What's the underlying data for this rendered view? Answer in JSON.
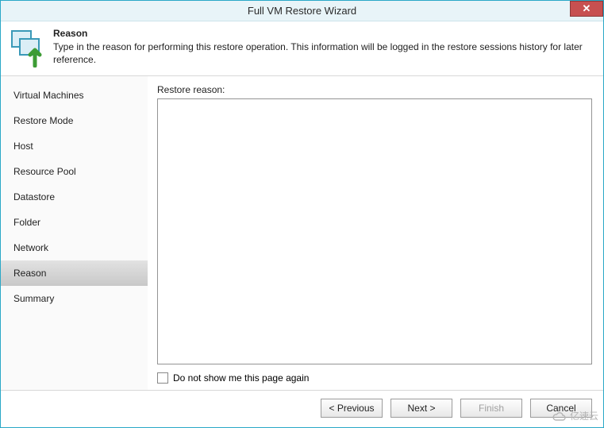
{
  "window": {
    "title": "Full VM Restore Wizard"
  },
  "header": {
    "title": "Reason",
    "description": "Type in the reason for performing this restore operation. This information will be logged in the restore sessions history for later reference."
  },
  "sidebar": {
    "items": [
      {
        "label": "Virtual Machines",
        "active": false
      },
      {
        "label": "Restore Mode",
        "active": false
      },
      {
        "label": "Host",
        "active": false
      },
      {
        "label": "Resource Pool",
        "active": false
      },
      {
        "label": "Datastore",
        "active": false
      },
      {
        "label": "Folder",
        "active": false
      },
      {
        "label": "Network",
        "active": false
      },
      {
        "label": "Reason",
        "active": true
      },
      {
        "label": "Summary",
        "active": false
      }
    ]
  },
  "main": {
    "reason_label": "Restore reason:",
    "reason_value": "",
    "checkbox_label": "Do not show me this page again",
    "checkbox_checked": false
  },
  "footer": {
    "previous": "< Previous",
    "next": "Next >",
    "finish": "Finish",
    "cancel": "Cancel"
  },
  "watermark": "亿速云"
}
